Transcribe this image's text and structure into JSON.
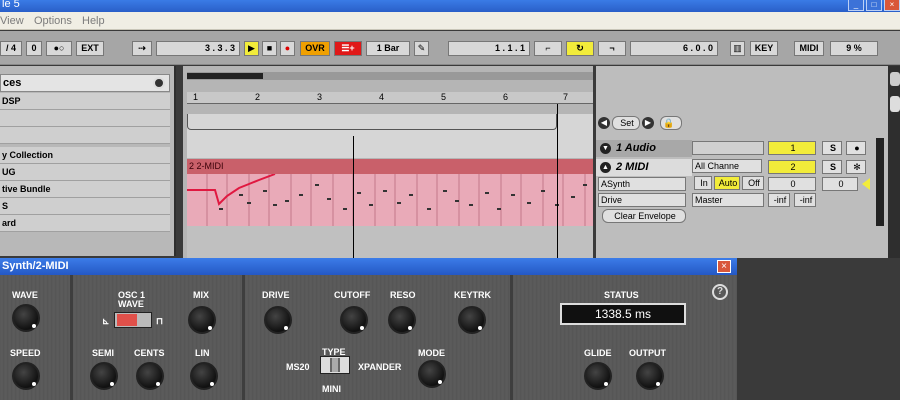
{
  "window": {
    "title": "le 5"
  },
  "menu": [
    "View",
    "Options",
    "Help"
  ],
  "transport": {
    "sig_num": "/ 4",
    "sig_den": "0",
    "ext": "EXT",
    "pos": "3 .  3 .  3",
    "ovr": "OVR",
    "quant": "1 Bar",
    "pos2": "1 .  1 .  1",
    "len": "6 .  0 .  0",
    "key": "KEY",
    "midi": "MIDI",
    "cpu": "9 %"
  },
  "browser": {
    "title": "ces",
    "items": [
      "DSP",
      "",
      "",
      "y Collection",
      "UG",
      "tive Bundle",
      "S",
      "ard"
    ]
  },
  "ruler": [
    "1",
    "2",
    "3",
    "4",
    "5",
    "6",
    "7"
  ],
  "tracks": {
    "set_label": "Set",
    "audio": {
      "name": "1 Audio",
      "num": "1",
      "solo": "S"
    },
    "midi": {
      "name": "2 MIDI",
      "clip": "2 2-MIDI",
      "num": "2",
      "solo": "S",
      "input": "All Channe",
      "device": "ASynth",
      "param": "Drive",
      "monitor_in": "In",
      "monitor_auto": "Auto",
      "monitor_off": "Off",
      "vol": "0",
      "pan": "0",
      "output": "Master",
      "send1": "-inf",
      "send2": "-inf",
      "clear": "Clear Envelope"
    }
  },
  "plugin": {
    "title": "Synth/2-MIDI",
    "labels": {
      "wave": "WAVE",
      "speed": "SPEED",
      "osc": "OSC 1",
      "osc_wave": "WAVE",
      "mix": "MIX",
      "semi": "SEMI",
      "cents": "CENTS",
      "lin": "LIN",
      "drive": "DRIVE",
      "cutoff": "CUTOFF",
      "reso": "RESO",
      "keytrk": "KEYTRK",
      "type": "TYPE",
      "ms20": "MS20",
      "xpander": "XPANDER",
      "mini": "MINI",
      "mode": "MODE",
      "status": "STATUS",
      "glide": "GLIDE",
      "output": "OUTPUT"
    },
    "status_value": "1338.5 ms",
    "help": "?"
  }
}
